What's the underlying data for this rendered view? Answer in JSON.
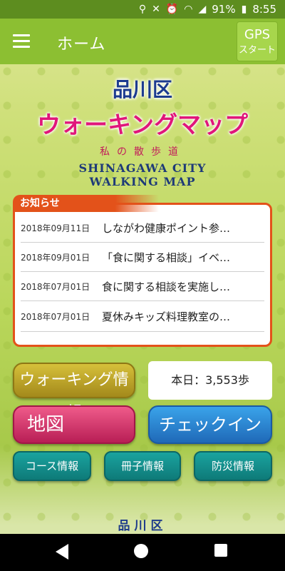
{
  "status": {
    "battery": "91%",
    "time": "8:55"
  },
  "appbar": {
    "title": "ホーム",
    "gps_line1": "GPS",
    "gps_line2": "スタート"
  },
  "logo": {
    "ward": "品川区",
    "main": "ウォーキングマップ",
    "sub": "私の散歩道",
    "en_line1": "SHINAGAWA CITY",
    "en_line2": "WALKING MAP"
  },
  "notice": {
    "header": "お知らせ",
    "items": [
      {
        "date": "2018年09月11日",
        "text": "しながわ健康ポイント参…"
      },
      {
        "date": "2018年09月01日",
        "text": "「食に関する相談」イベ…"
      },
      {
        "date": "2018年07月01日",
        "text": "食に関する相談を実施し…"
      },
      {
        "date": "2018年07月01日",
        "text": "夏休みキッズ料理教室の…"
      }
    ]
  },
  "buttons": {
    "walking": "ウォーキング情報",
    "steps": "本日：3,553歩",
    "map": "地図",
    "checkin": "チェックイン",
    "course": "コース情報",
    "booklet": "冊子情報",
    "disaster": "防災情報"
  },
  "footer": {
    "logo": "品川区"
  },
  "colors": {
    "appbar": "#8cbf32",
    "notice_border": "#e3521a",
    "walk": "#c4ab2e",
    "map": "#d8326e",
    "checkin": "#2b86d6",
    "small": "#13918e"
  }
}
